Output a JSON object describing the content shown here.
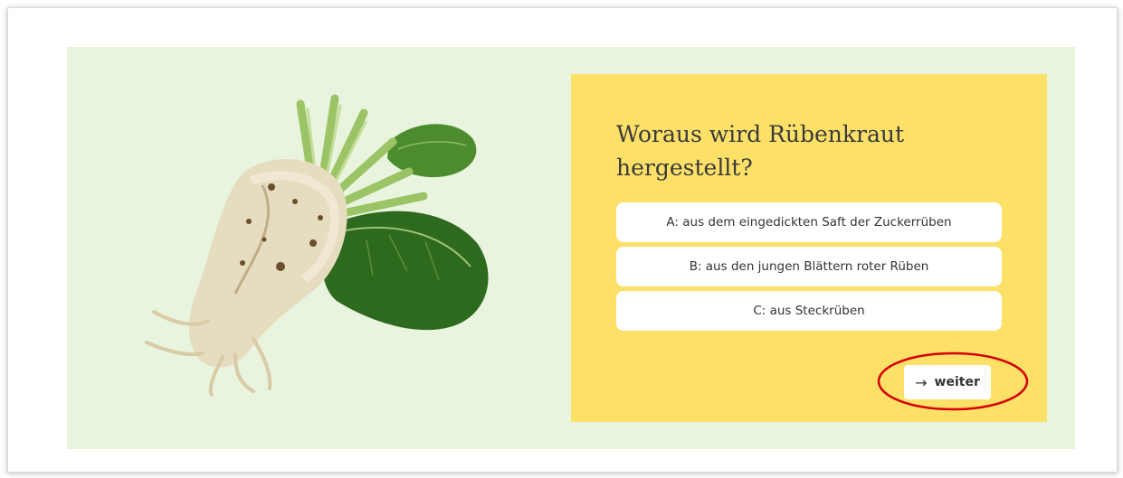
{
  "quiz": {
    "question": "Woraus wird Rübenkraut hergestellt?",
    "answers": [
      "A: aus dem eingedickten Saft der Zuckerrüben",
      "B: aus den jungen Blättern roter Rüben",
      "C: aus Steckrüben"
    ],
    "next_arrow": "→",
    "next_label": "weiter"
  },
  "image": {
    "subject": "sugar-beet"
  },
  "colors": {
    "panel_bg": "#e9f4de",
    "card_bg": "#fde068",
    "highlight": "#d40000"
  }
}
